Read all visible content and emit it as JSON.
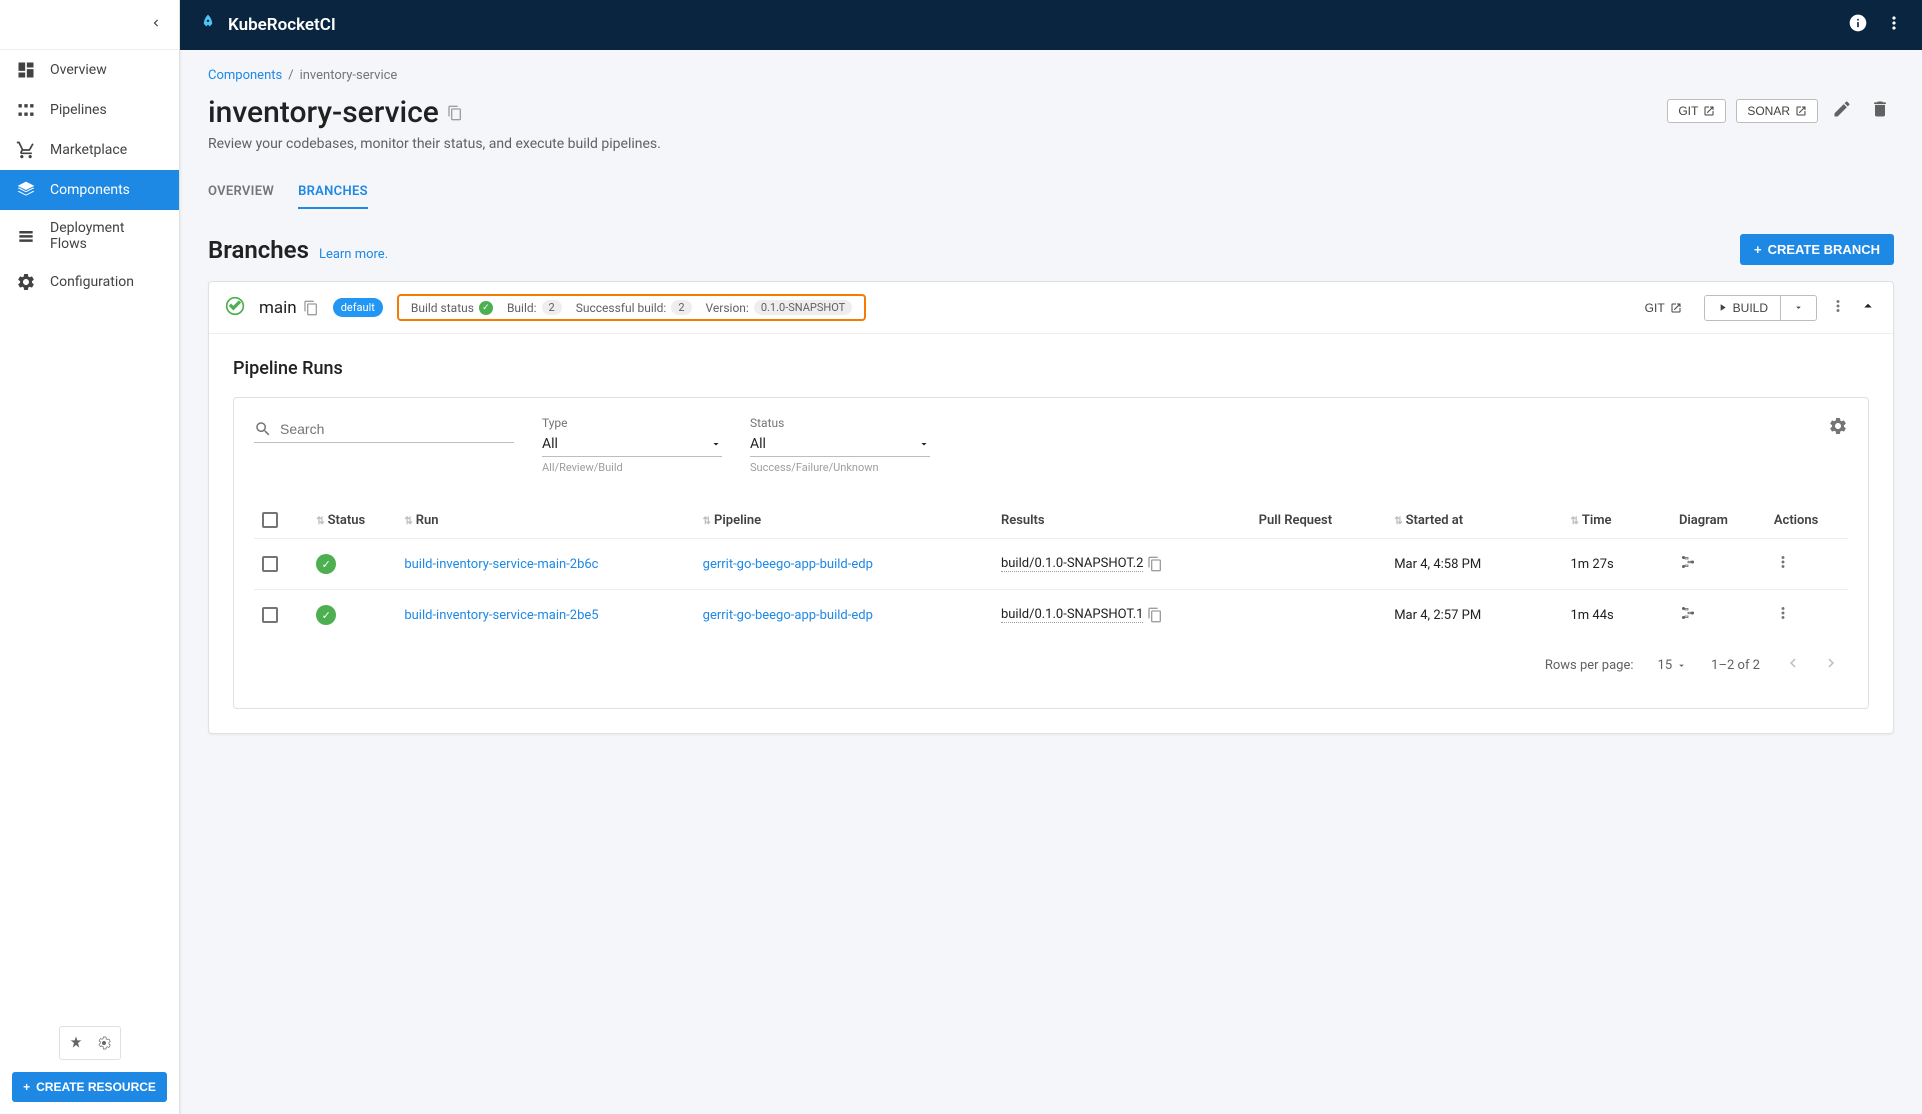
{
  "brand": "KubeRocketCI",
  "sidebar": {
    "items": [
      {
        "label": "Overview"
      },
      {
        "label": "Pipelines"
      },
      {
        "label": "Marketplace"
      },
      {
        "label": "Components"
      },
      {
        "label": "Deployment Flows"
      },
      {
        "label": "Configuration"
      }
    ],
    "create_resource": "CREATE RESOURCE"
  },
  "breadcrumb": {
    "root": "Components",
    "current": "inventory-service"
  },
  "page": {
    "title": "inventory-service",
    "subtitle": "Review your codebases, monitor their status, and execute build pipelines.",
    "actions": {
      "git": "GIT",
      "sonar": "SONAR"
    }
  },
  "tabs": [
    {
      "label": "OVERVIEW"
    },
    {
      "label": "BRANCHES"
    }
  ],
  "section": {
    "title": "Branches",
    "learn_more": "Learn more.",
    "create_branch": "CREATE BRANCH"
  },
  "branch": {
    "name": "main",
    "default_badge": "default",
    "stats": {
      "build_status_label": "Build status",
      "build_label": "Build:",
      "build_count": "2",
      "successful_label": "Successful build:",
      "successful_count": "2",
      "version_label": "Version:",
      "version": "0.1.0-SNAPSHOT"
    },
    "actions": {
      "git": "GIT",
      "build": "BUILD"
    }
  },
  "runs": {
    "title": "Pipeline Runs",
    "search_placeholder": "Search",
    "filters": {
      "type": {
        "label": "Type",
        "value": "All",
        "hint": "All/Review/Build"
      },
      "status": {
        "label": "Status",
        "value": "All",
        "hint": "Success/Failure/Unknown"
      }
    },
    "columns": {
      "status": "Status",
      "run": "Run",
      "pipeline": "Pipeline",
      "results": "Results",
      "pull_request": "Pull Request",
      "started_at": "Started at",
      "time": "Time",
      "diagram": "Diagram",
      "actions": "Actions"
    },
    "rows": [
      {
        "run": "build-inventory-service-main-2b6c",
        "pipeline": "gerrit-go-beego-app-build-edp",
        "results": "build/0.1.0-SNAPSHOT.2",
        "started_at": "Mar 4, 4:58 PM",
        "time": "1m 27s"
      },
      {
        "run": "build-inventory-service-main-2be5",
        "pipeline": "gerrit-go-beego-app-build-edp",
        "results": "build/0.1.0-SNAPSHOT.1",
        "started_at": "Mar 4, 2:57 PM",
        "time": "1m 44s"
      }
    ],
    "footer": {
      "rows_per_page_label": "Rows per page:",
      "rows_per_page": "15",
      "range": "1–2 of 2"
    }
  }
}
